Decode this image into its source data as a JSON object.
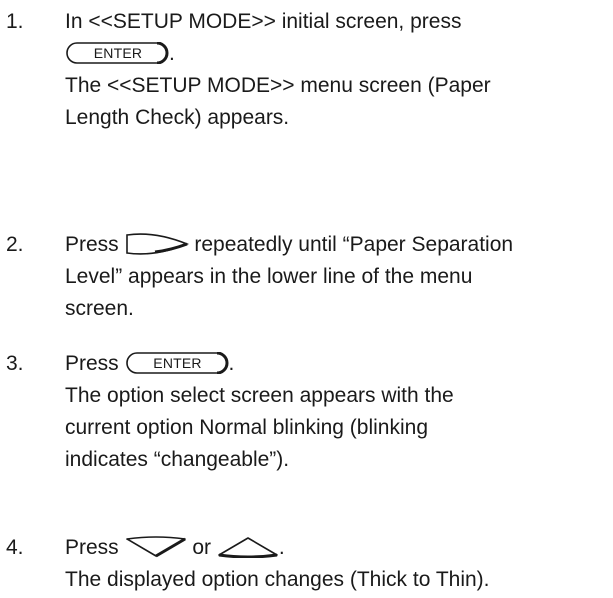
{
  "steps": [
    {
      "number": "1.",
      "line1": "In <<SETUP MODE>> initial screen, press",
      "key_label": "ENTER",
      "after_key": ".",
      "desc1": "The <<SETUP MODE>> menu screen (Paper",
      "desc2": "Length Check) appears."
    },
    {
      "number": "2.",
      "press": "Press",
      "key_icon": "right-arrow-key",
      "after_key": "repeatedly until “Paper Separation",
      "desc1": "Level” appears in the lower line of the menu",
      "desc2": "screen."
    },
    {
      "number": "3.",
      "press": "Press",
      "key_label": "ENTER",
      "after_key": ".",
      "desc1": "The option select screen appears with the",
      "desc2": "current option Normal blinking (blinking",
      "desc3": "indicates “changeable”)."
    },
    {
      "number": "4.",
      "press": "Press",
      "key1_icon": "down-arrow-key",
      "or": "or",
      "key2_icon": "up-arrow-key",
      "after_key": ".",
      "desc1": "The displayed option changes (Thick to Thin)."
    }
  ]
}
